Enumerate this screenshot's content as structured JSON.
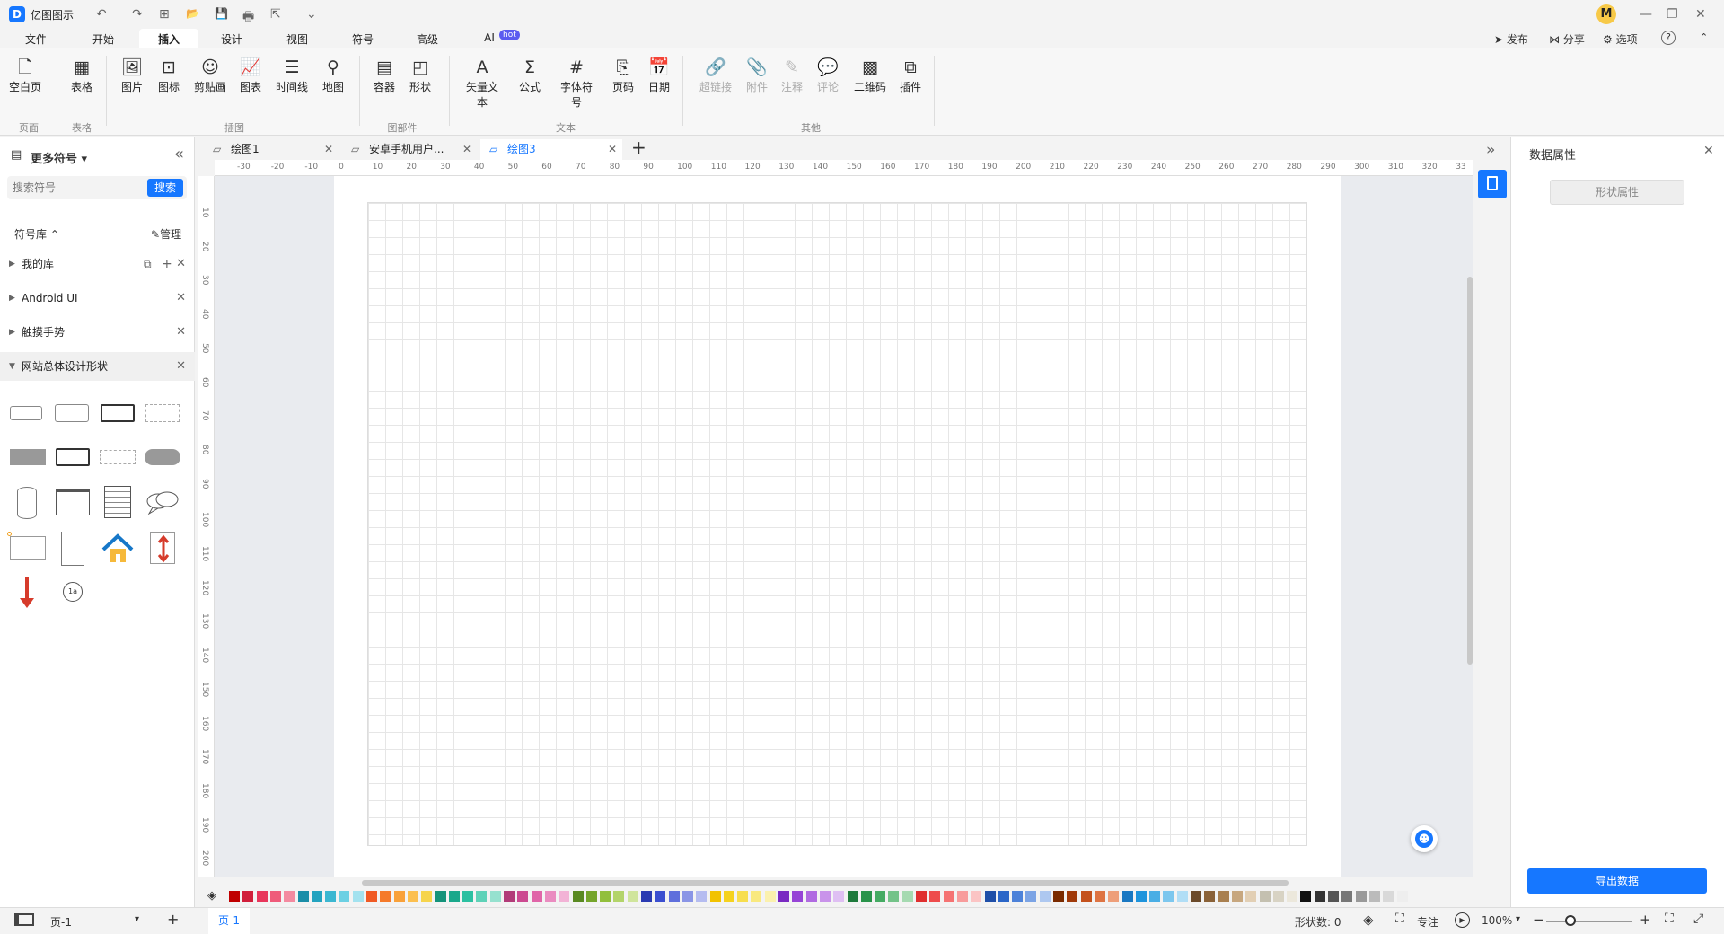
{
  "app": {
    "title": "亿图图示",
    "avatar_letter": "M"
  },
  "titlebar": {
    "undo": "↶",
    "redo": "↷",
    "new": "⊞",
    "open": "📂",
    "save": "💾",
    "print": "🖶",
    "export": "⇱",
    "more": "⌄",
    "minimize": "—",
    "restore": "❐",
    "close": "✕"
  },
  "menu": {
    "items": [
      "文件",
      "开始",
      "插入",
      "设计",
      "视图",
      "符号",
      "高级",
      "AI"
    ],
    "hot": "hot",
    "active": "插入",
    "right": {
      "publish": "发布",
      "share": "分享",
      "options": "选项",
      "help": "?"
    }
  },
  "ribbon": {
    "buttons": [
      "空白页",
      "表格",
      "图片",
      "图标",
      "剪贴画",
      "图表",
      "时间线",
      "地图",
      "容器",
      "形状",
      "矢量文本",
      "公式",
      "字体符号",
      "页码",
      "日期",
      "超链接",
      "附件",
      "注释",
      "评论",
      "二维码",
      "插件"
    ],
    "icons": [
      "🗋",
      "▦",
      "🖼",
      "⊡",
      "☺",
      "📈",
      "☰",
      "⚲",
      "▤",
      "◰",
      "A",
      "Σ",
      "#",
      "⎘",
      "📅",
      "🔗",
      "📎",
      "✎",
      "💬",
      "▩",
      "⧉"
    ],
    "groups": [
      "页面",
      "表格",
      "插图",
      "图部件",
      "文本",
      "其他"
    ]
  },
  "leftpanel": {
    "title": "更多符号",
    "collapse_icon": "«",
    "search_placeholder": "搜索符号",
    "search_button": "搜索",
    "library_label": "符号库",
    "manage_label": "管理",
    "libraries": [
      {
        "name": "我的库"
      },
      {
        "name": "Android UI"
      },
      {
        "name": "触摸手势"
      },
      {
        "name": "网站总体设计形状"
      }
    ],
    "shape_text": "1a"
  },
  "tabs": [
    {
      "label": "绘图1"
    },
    {
      "label": "安卓手机用户..."
    },
    {
      "label": "绘图3",
      "active": true
    }
  ],
  "ruler": {
    "h": [
      "-30",
      "-20",
      "-10",
      "0",
      "10",
      "20",
      "30",
      "40",
      "50",
      "60",
      "70",
      "80",
      "90",
      "100",
      "110",
      "120",
      "130",
      "140",
      "150",
      "160",
      "170",
      "180",
      "190",
      "200",
      "210",
      "220",
      "230",
      "240",
      "250",
      "260",
      "270",
      "280",
      "290",
      "300",
      "310",
      "320",
      "33"
    ],
    "v": [
      "10",
      "20",
      "30",
      "40",
      "50",
      "60",
      "70",
      "80",
      "90",
      "100",
      "110",
      "120",
      "130",
      "140",
      "150",
      "160",
      "170",
      "180",
      "190",
      "200"
    ]
  },
  "rightpanel": {
    "title": "数据属性",
    "shape_props": "形状属性",
    "export": "导出数据",
    "expand_icon": "»"
  },
  "status": {
    "page_label": "页-1",
    "page_tab": "页-1",
    "add_page": "+",
    "shape_count": "形状数: 0",
    "focus": "专注",
    "zoom": "100%",
    "zoom_minus": "−",
    "zoom_plus": "+"
  },
  "colors": [
    "#c00000",
    "#d11f3b",
    "#e8365b",
    "#ef5b7a",
    "#f48aa0",
    "#1b8ea8",
    "#23a3bf",
    "#3bb7d1",
    "#6cd0e3",
    "#a3e2ef",
    "#f05a24",
    "#f57a2a",
    "#f9a13a",
    "#fcbf4f",
    "#f6d44c",
    "#14937a",
    "#1aa88b",
    "#2cc0a1",
    "#5fd2b8",
    "#96e1cf",
    "#b23c79",
    "#cc4a91",
    "#e065a8",
    "#ea8cc0",
    "#f2b3d6",
    "#5a8a22",
    "#75a52b",
    "#92bf3c",
    "#b3d46a",
    "#d0e59c",
    "#2a3ab2",
    "#3b4fd0",
    "#5f6fdc",
    "#8a95e6",
    "#b5bcf0",
    "#f2c200",
    "#f5d21f",
    "#f7de4e",
    "#f9e97f",
    "#fbf1ad",
    "#7a2ac2",
    "#9644d6",
    "#b06ae1",
    "#c993ea",
    "#dfbff3",
    "#1e7a3c",
    "#29934a",
    "#45ab63",
    "#74c389",
    "#a6dab1",
    "#e02f2f",
    "#ee4c4c",
    "#f57373",
    "#f89c9c",
    "#fbc4c4",
    "#1f4fa8",
    "#2b66c8",
    "#4d82d9",
    "#7ca4e5",
    "#aec8f0",
    "#7a2b00",
    "#a03a0a",
    "#c4511c",
    "#de7443",
    "#ee9f7a",
    "#1a78c2",
    "#1f94dc",
    "#4aaee5",
    "#7dc7ee",
    "#b1def6",
    "#6b4a2a",
    "#8a6238",
    "#a98050",
    "#c7a77f",
    "#e2cfb4",
    "#c4c0b0",
    "#d8d3c4",
    "#ece8dc",
    "#111111",
    "#333333",
    "#555555",
    "#777777",
    "#999999",
    "#bbbbbb",
    "#d9d9d9",
    "#eeeeee"
  ]
}
